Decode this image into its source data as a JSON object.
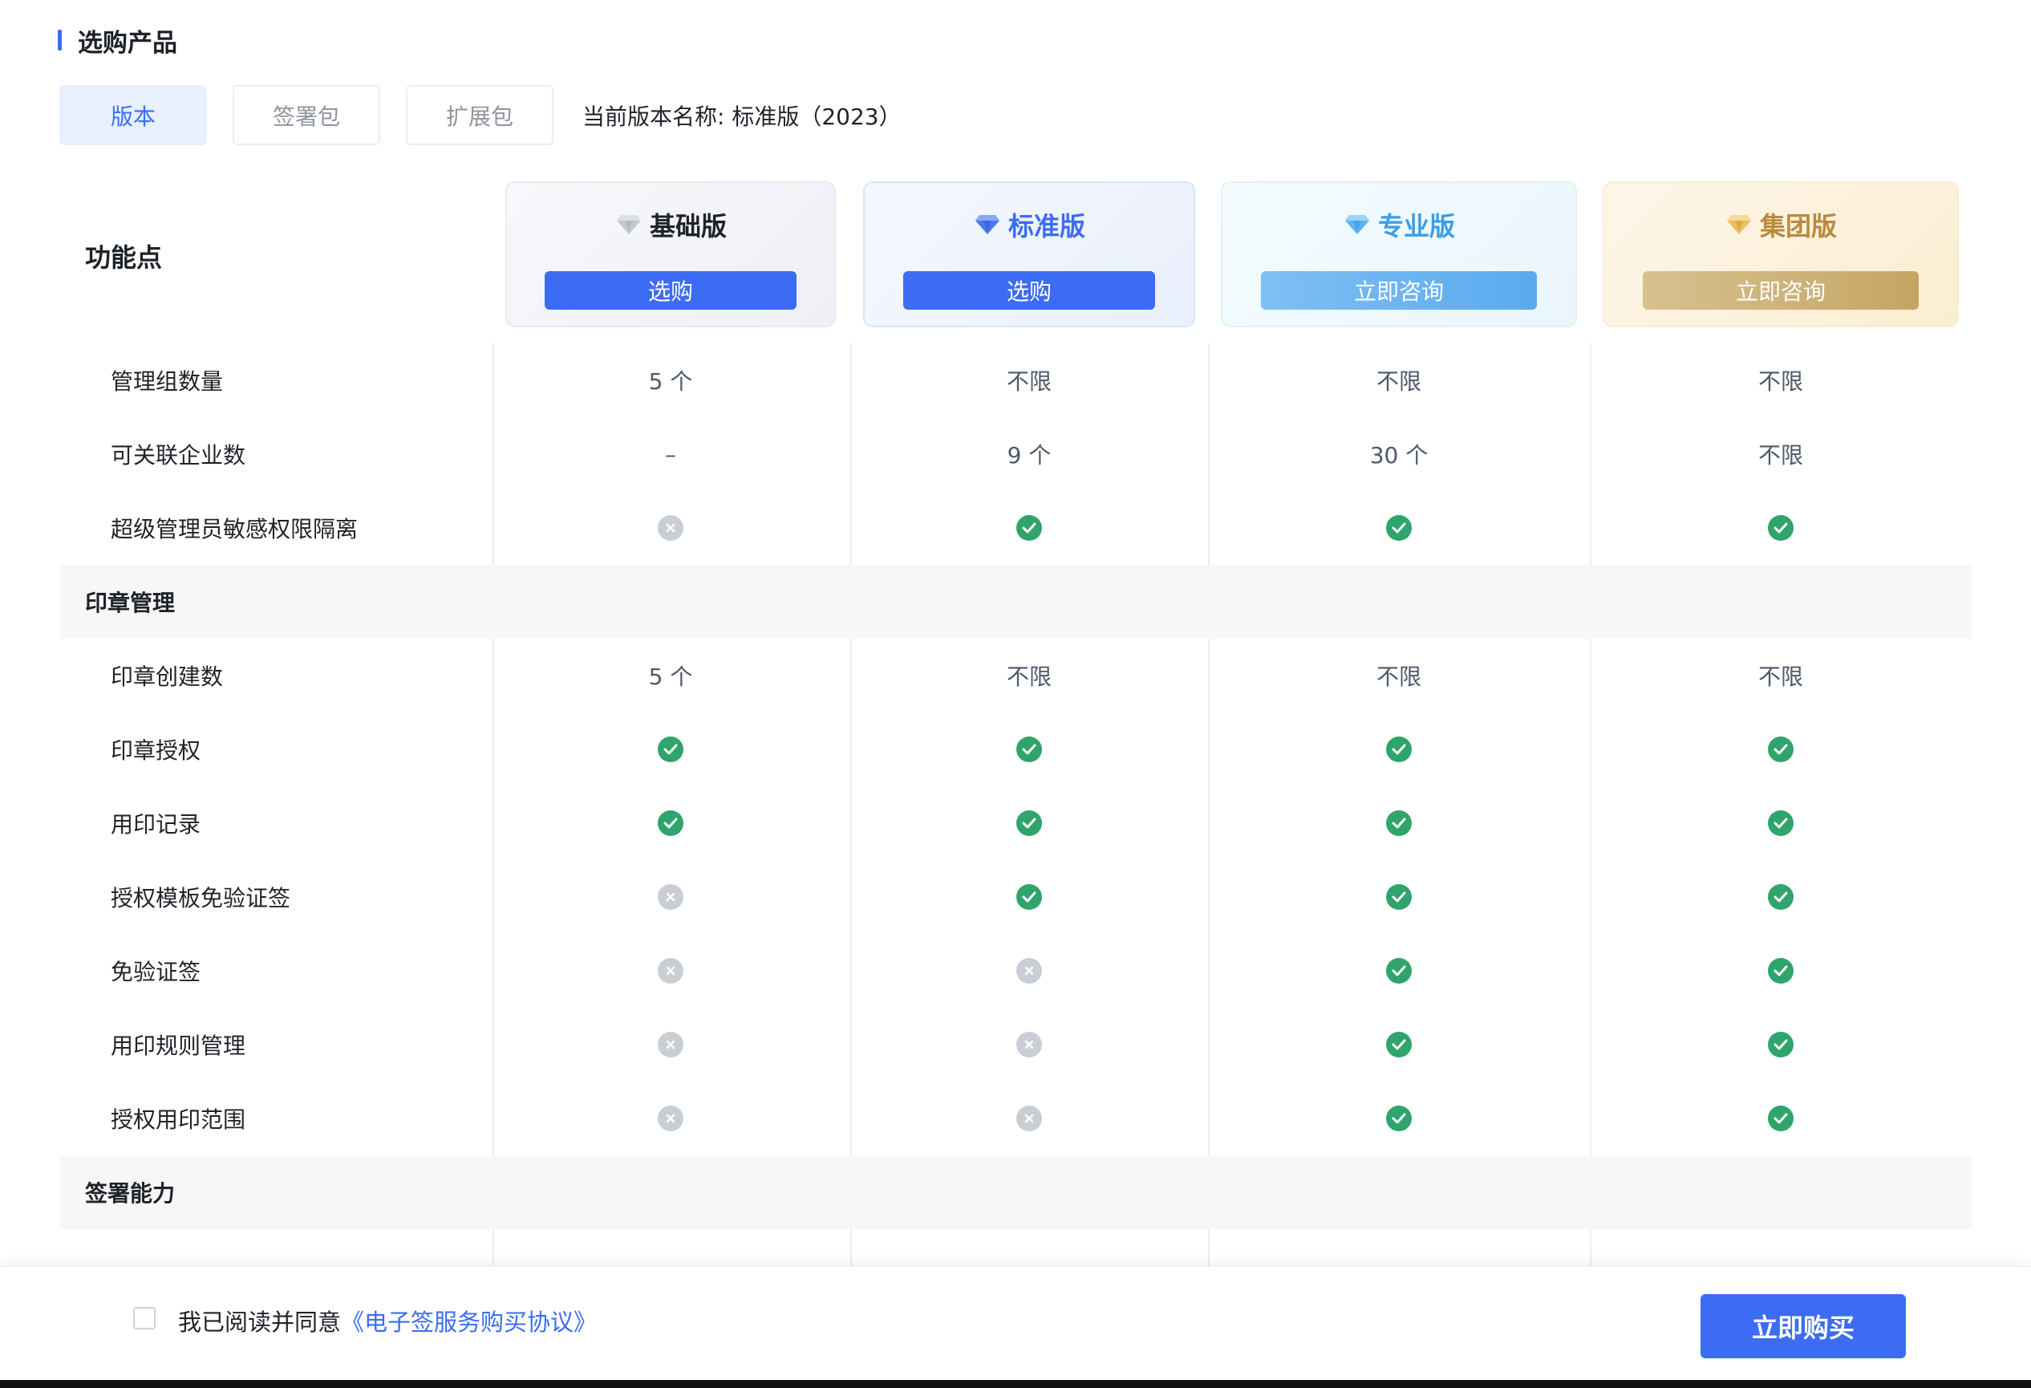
{
  "section": {
    "title": "选购产品"
  },
  "tabs": [
    {
      "label": "版本",
      "active": true
    },
    {
      "label": "签署包",
      "active": false
    },
    {
      "label": "扩展包",
      "active": false
    }
  ],
  "current_version": "当前版本名称: 标准版（2023）",
  "table": {
    "feature_header": "功能点",
    "plans": [
      {
        "name": "基础版",
        "button": "选购",
        "icon": "diamond-icon",
        "color": "#8f959e"
      },
      {
        "name": "标准版",
        "button": "选购",
        "icon": "diamond-icon",
        "color": "#3b6cf3"
      },
      {
        "name": "专业版",
        "button": "立即咨询",
        "icon": "diamond-icon",
        "color": "#3a9ee8"
      },
      {
        "name": "集团版",
        "button": "立即咨询",
        "icon": "diamond-icon",
        "color": "#e0b35a"
      }
    ],
    "rows": [
      {
        "label": "管理组数量",
        "group": false,
        "values": [
          "5 个",
          "不限",
          "不限",
          "不限"
        ]
      },
      {
        "label": "可关联企业数",
        "group": false,
        "values": [
          "–",
          "9 个",
          "30 个",
          "不限"
        ]
      },
      {
        "label": "超级管理员敏感权限隔离",
        "group": false,
        "values": [
          "no",
          "yes",
          "yes",
          "yes"
        ]
      },
      {
        "label": "印章管理",
        "group": true,
        "values": []
      },
      {
        "label": "印章创建数",
        "group": false,
        "values": [
          "5 个",
          "不限",
          "不限",
          "不限"
        ]
      },
      {
        "label": "印章授权",
        "group": false,
        "values": [
          "yes",
          "yes",
          "yes",
          "yes"
        ]
      },
      {
        "label": "用印记录",
        "group": false,
        "values": [
          "yes",
          "yes",
          "yes",
          "yes"
        ]
      },
      {
        "label": "授权模板免验证签",
        "group": false,
        "values": [
          "no",
          "yes",
          "yes",
          "yes"
        ]
      },
      {
        "label": "免验证签",
        "group": false,
        "values": [
          "no",
          "no",
          "yes",
          "yes"
        ]
      },
      {
        "label": "用印规则管理",
        "group": false,
        "values": [
          "no",
          "no",
          "yes",
          "yes"
        ]
      },
      {
        "label": "授权用印范围",
        "group": false,
        "values": [
          "no",
          "no",
          "yes",
          "yes"
        ]
      },
      {
        "label": "签署能力",
        "group": true,
        "values": []
      }
    ]
  },
  "footer": {
    "agree_prefix": "我已阅读并同意",
    "agree_link": "《电子签服务购买协议》",
    "agreed": false,
    "buy_button": "立即购买"
  },
  "colors": {
    "accent": "#3b6cf3",
    "yes": "#2fa46b",
    "no": "#c9cdd4"
  }
}
